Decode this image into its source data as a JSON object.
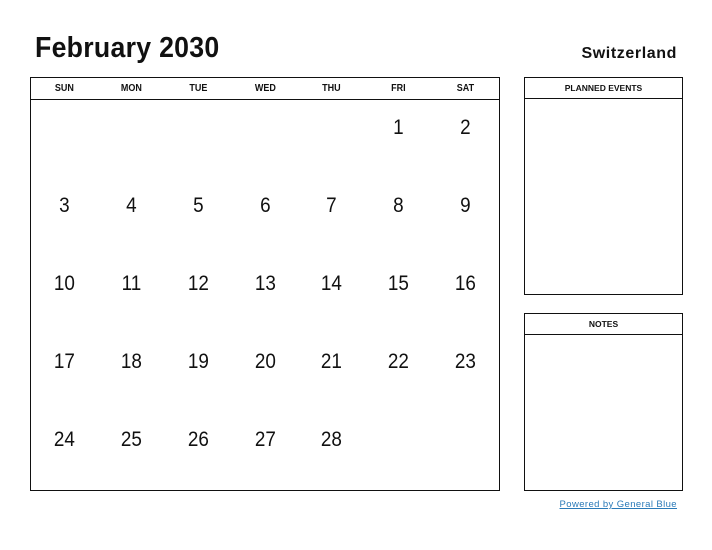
{
  "header": {
    "title": "February 2030",
    "country": "Switzerland"
  },
  "calendar": {
    "weekdays": [
      "SUN",
      "MON",
      "TUE",
      "WED",
      "THU",
      "FRI",
      "SAT"
    ],
    "cells": [
      "",
      "",
      "",
      "",
      "",
      "1",
      "2",
      "3",
      "4",
      "5",
      "6",
      "7",
      "8",
      "9",
      "10",
      "11",
      "12",
      "13",
      "14",
      "15",
      "16",
      "17",
      "18",
      "19",
      "20",
      "21",
      "22",
      "23",
      "24",
      "25",
      "26",
      "27",
      "28",
      "",
      ""
    ]
  },
  "sidebar": {
    "events_label": "PLANNED EVENTS",
    "notes_label": "NOTES"
  },
  "footer": {
    "link_text": "Powered by General Blue"
  }
}
